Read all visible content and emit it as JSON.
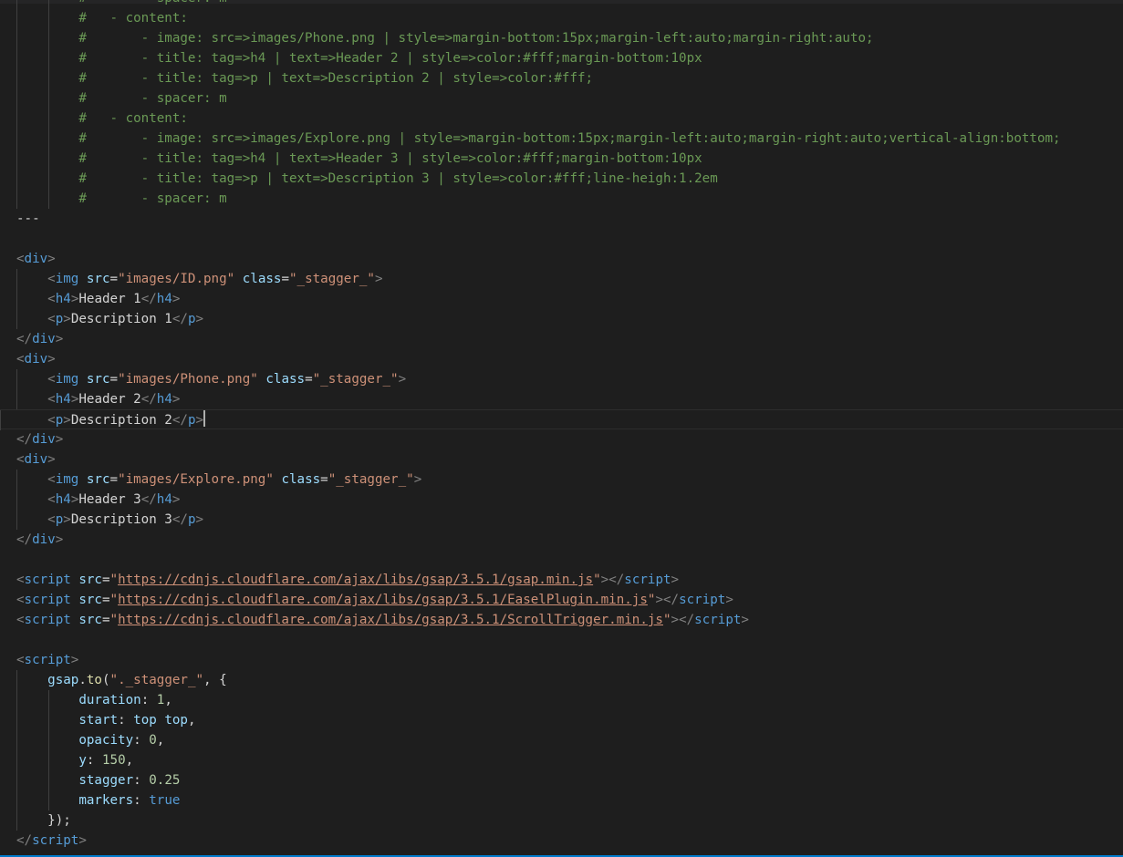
{
  "editor": {
    "theme_background": "#1e1e1e",
    "lines": [
      {
        "type": "comment",
        "text": "#       - spacer: m"
      },
      {
        "type": "comment",
        "text": "#   - content:"
      },
      {
        "type": "comment",
        "text": "#       - image: src=>images/Phone.png | style=>margin-bottom:15px;margin-left:auto;margin-right:auto;"
      },
      {
        "type": "comment",
        "text": "#       - title: tag=>h4 | text=>Header 2 | style=>color:#fff;margin-bottom:10px"
      },
      {
        "type": "comment",
        "text": "#       - title: tag=>p | text=>Description 2 | style=>color:#fff;"
      },
      {
        "type": "comment",
        "text": "#       - spacer: m"
      },
      {
        "type": "comment",
        "text": "#   - content:"
      },
      {
        "type": "comment",
        "text": "#       - image: src=>images/Explore.png | style=>margin-bottom:15px;margin-left:auto;margin-right:auto;vertical-align:bottom;"
      },
      {
        "type": "comment",
        "text": "#       - title: tag=>h4 | text=>Header 3 | style=>color:#fff;margin-bottom:10px"
      },
      {
        "type": "comment",
        "text": "#       - title: tag=>p | text=>Description 3 | style=>color:#fff;line-heigh:1.2em"
      },
      {
        "type": "comment",
        "text": "#       - spacer: m"
      },
      {
        "type": "separator",
        "text": "---"
      },
      {
        "type": "blank",
        "text": ""
      },
      {
        "type": "open",
        "tag": "div"
      },
      {
        "type": "img",
        "src": "images/ID.png",
        "class": "_stagger_"
      },
      {
        "type": "h4",
        "text": "Header 1"
      },
      {
        "type": "p",
        "text": "Description 1"
      },
      {
        "type": "close",
        "tag": "div"
      },
      {
        "type": "open",
        "tag": "div"
      },
      {
        "type": "img",
        "src": "images/Phone.png",
        "class": "_stagger_"
      },
      {
        "type": "h4",
        "text": "Header 2"
      },
      {
        "type": "p",
        "text": "Description 2",
        "cursor": true
      },
      {
        "type": "close",
        "tag": "div"
      },
      {
        "type": "open",
        "tag": "div"
      },
      {
        "type": "img",
        "src": "images/Explore.png",
        "class": "_stagger_"
      },
      {
        "type": "h4",
        "text": "Header 3"
      },
      {
        "type": "p",
        "text": "Description 3"
      },
      {
        "type": "close",
        "tag": "div"
      },
      {
        "type": "blank",
        "text": ""
      },
      {
        "type": "script_src",
        "src": "https://cdnjs.cloudflare.com/ajax/libs/gsap/3.5.1/gsap.min.js"
      },
      {
        "type": "script_src",
        "src": "https://cdnjs.cloudflare.com/ajax/libs/gsap/3.5.1/EaselPlugin.min.js"
      },
      {
        "type": "script_src",
        "src": "https://cdnjs.cloudflare.com/ajax/libs/gsap/3.5.1/ScrollTrigger.min.js"
      },
      {
        "type": "blank",
        "text": ""
      },
      {
        "type": "open",
        "tag": "script"
      },
      {
        "type": "js_call",
        "fn": "gsap.to",
        "arg": "\"._stagger_\""
      },
      {
        "type": "js_prop",
        "key": "duration",
        "value": "1",
        "vtype": "num",
        "comma": true
      },
      {
        "type": "js_prop",
        "key": "start",
        "value": "top top",
        "vtype": "prop",
        "comma": true
      },
      {
        "type": "js_prop",
        "key": "opacity",
        "value": "0",
        "vtype": "num",
        "comma": true
      },
      {
        "type": "js_prop",
        "key": "y",
        "value": "150",
        "vtype": "num",
        "comma": true
      },
      {
        "type": "js_prop",
        "key": "stagger",
        "value": "0.25",
        "vtype": "num",
        "comma": false
      },
      {
        "type": "js_prop",
        "key": "markers",
        "value": "true",
        "vtype": "kw",
        "comma": false
      },
      {
        "type": "js_end",
        "text": "});"
      },
      {
        "type": "close",
        "tag": "script"
      }
    ]
  }
}
